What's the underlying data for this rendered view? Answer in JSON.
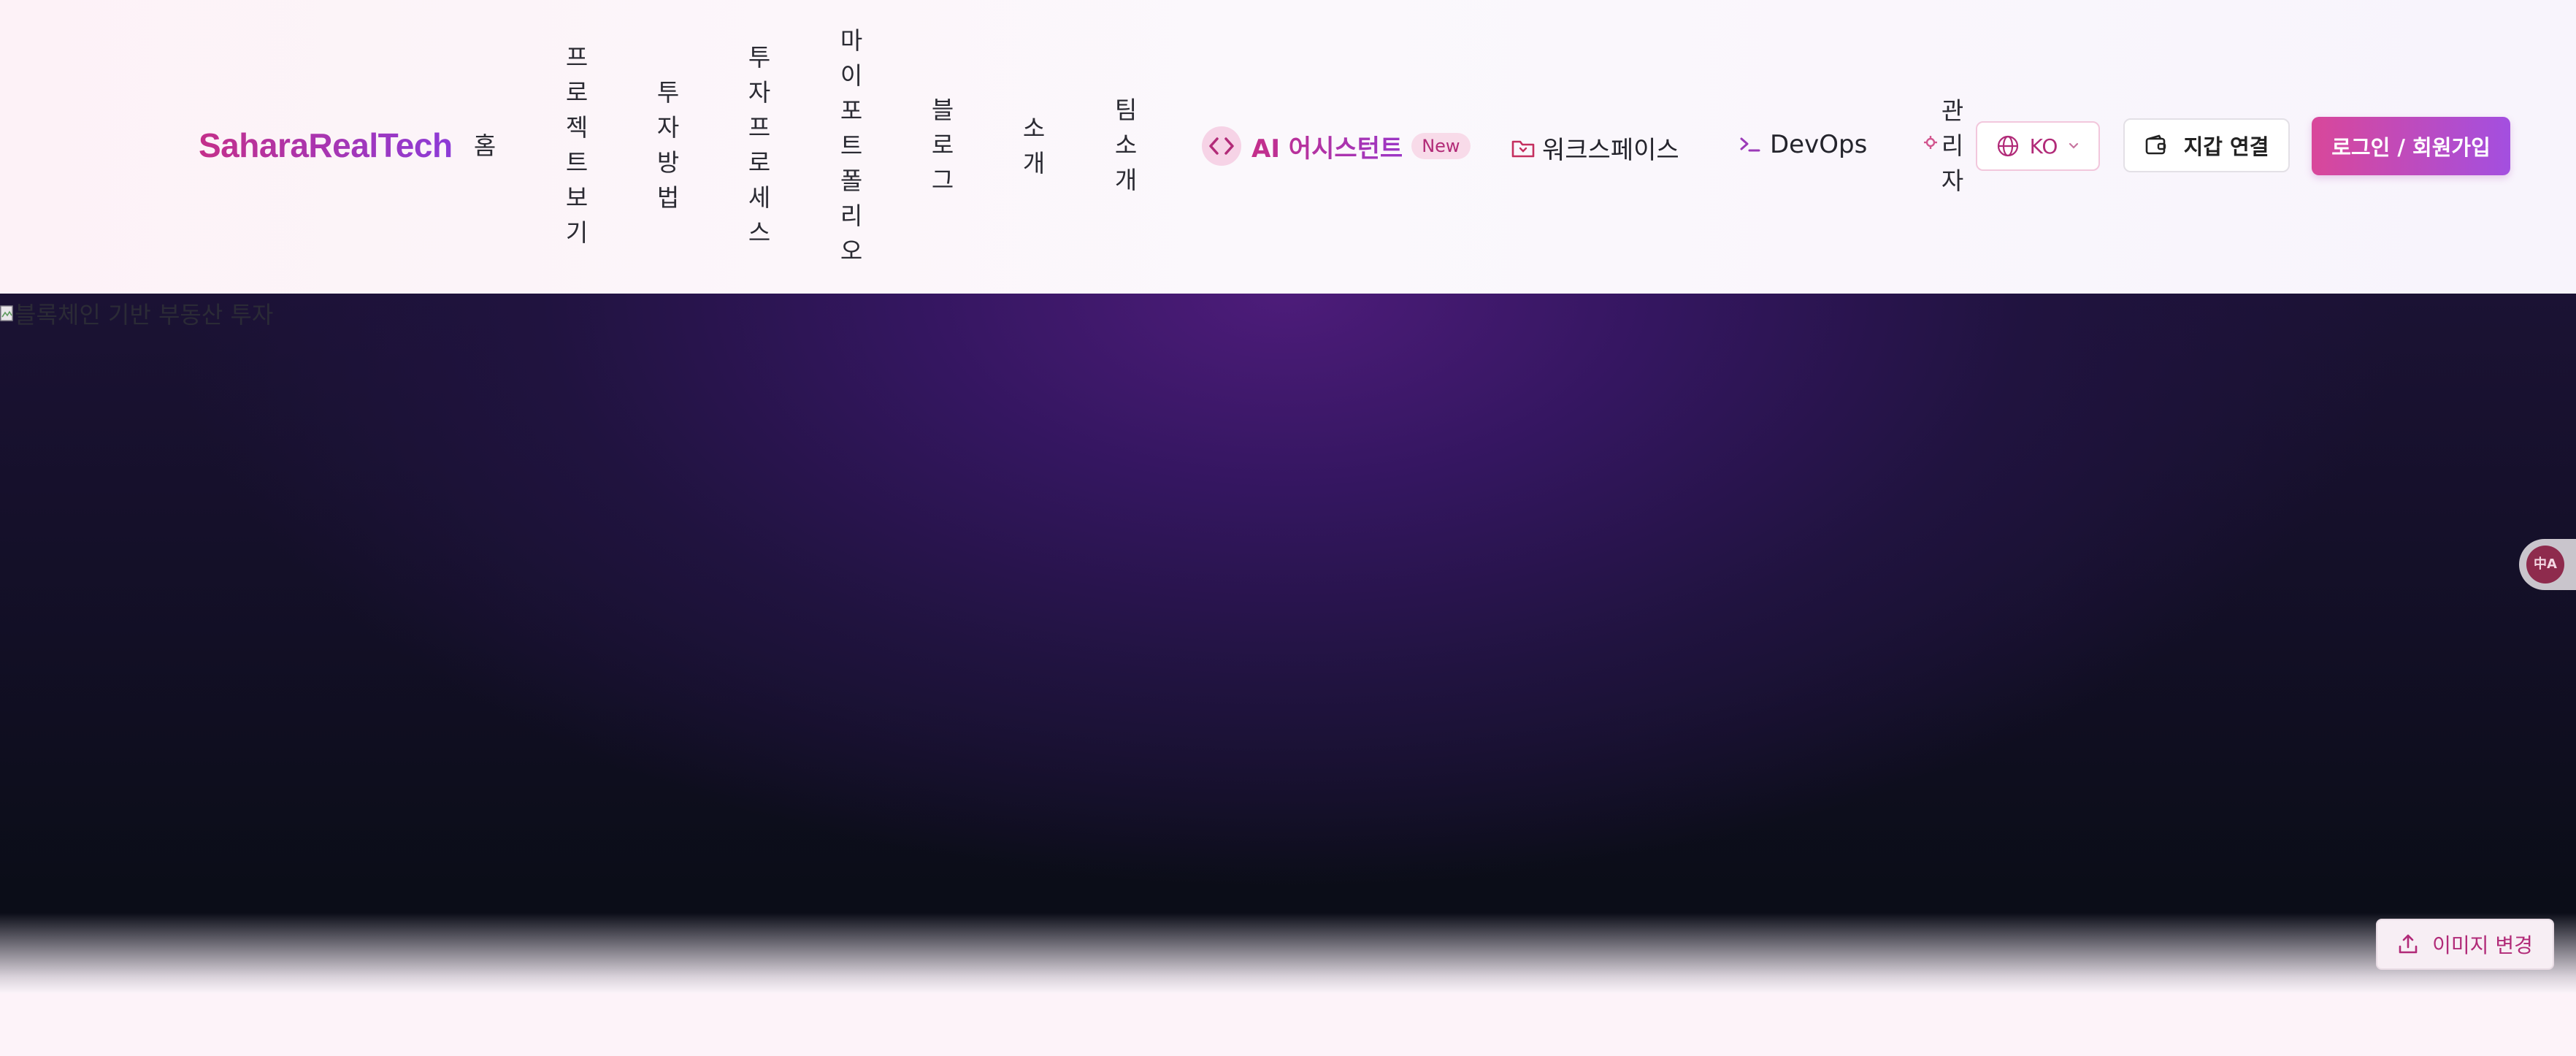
{
  "header": {
    "logo": "SaharaRealTech",
    "nav": {
      "home": "홈",
      "projects": "프로젝트보기",
      "how_to_invest": "투자방법",
      "process": "투자프로세스",
      "portfolio": "마이포트폴리오",
      "blog": "블로그",
      "about": "소개",
      "team": "팀소개",
      "ai_assistant": "AI 어시스턴트",
      "ai_badge": "New",
      "workspace": "워크스페이스",
      "devops": "DevOps",
      "admin": "관리자"
    },
    "language": "KO",
    "wallet_button": "지갑 연결",
    "login_button": "로그인 / 회원가입"
  },
  "hero": {
    "image_alt": "블록체인 기반 부동산 투자",
    "change_image_button": "이미지 변경"
  },
  "translate_widget": {
    "label": "中A"
  },
  "colors": {
    "brand_pink": "#c42f8a",
    "brand_purple": "#8c3bd8",
    "hero_dark": "#0b0d18"
  }
}
